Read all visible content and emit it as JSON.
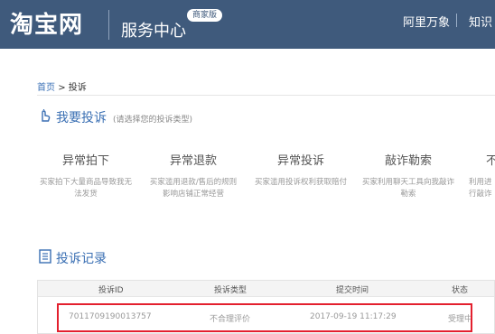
{
  "header": {
    "logo": "淘宝网",
    "title": "服务中心",
    "badge": "商家版",
    "nav": [
      "阿里万象",
      "知识"
    ]
  },
  "breadcrumb": {
    "home": "首页",
    "separator": ">",
    "current": "投诉"
  },
  "complain_section": {
    "title": "我要投诉",
    "hint": "(请选择您的投诉类型)"
  },
  "complaint_types": [
    {
      "title": "异常拍下",
      "desc": "买家拍下大量商品导致我无法发货"
    },
    {
      "title": "异常退款",
      "desc": "买家滥用退款/售后的规则影响店铺正常经营"
    },
    {
      "title": "异常投诉",
      "desc": "买家滥用投诉权利获取赔付"
    },
    {
      "title": "敲诈勒索",
      "desc": "买家利用聊天工具向我敲诈勒索"
    },
    {
      "title": "不",
      "desc": "利用进行敲诈"
    }
  ],
  "records_section": {
    "title": "投诉记录"
  },
  "table": {
    "headers": [
      "投诉ID",
      "投诉类型",
      "提交时间",
      "状态"
    ],
    "rows": [
      [
        "7011709190013757",
        "不合理评价",
        "2017-09-19 11:17:29",
        "受理中"
      ]
    ]
  },
  "colors": {
    "header_bg": "#3f5a7c",
    "accent": "#3a6fb3",
    "highlight": "#e3202e"
  }
}
